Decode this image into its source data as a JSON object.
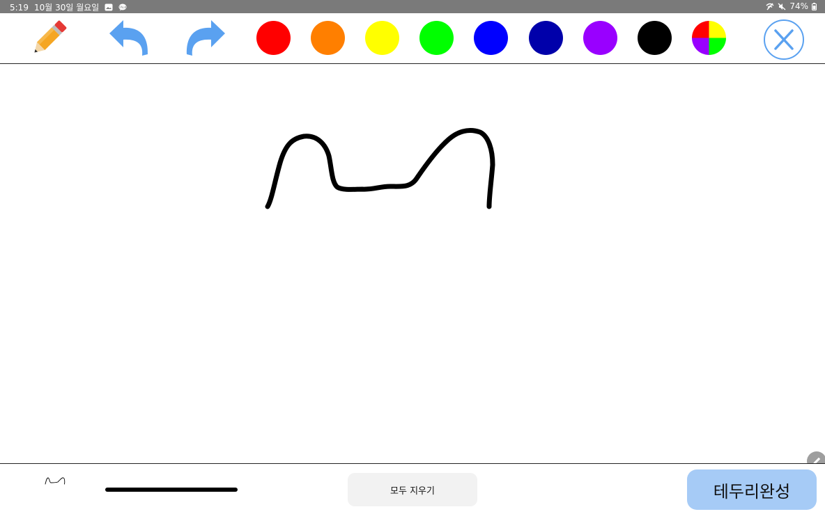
{
  "status_bar": {
    "time": "5:19",
    "date": "10월 30일 월요일",
    "battery": "74%"
  },
  "toolbar": {
    "pencil_icon": "pencil-icon",
    "undo_icon": "undo-arrow-icon",
    "redo_icon": "redo-arrow-icon",
    "close_icon": "close-x-icon",
    "colors": [
      {
        "name": "red",
        "hex": "#ff0000"
      },
      {
        "name": "orange",
        "hex": "#ff7f00"
      },
      {
        "name": "yellow",
        "hex": "#ffff00"
      },
      {
        "name": "green",
        "hex": "#00ff00"
      },
      {
        "name": "blue",
        "hex": "#0000ff"
      },
      {
        "name": "dark-blue",
        "hex": "#0000aa"
      },
      {
        "name": "purple",
        "hex": "#9900ff"
      },
      {
        "name": "black",
        "hex": "#000000"
      },
      {
        "name": "color-picker",
        "hex": "multi"
      }
    ],
    "accent_color": "#5aa1f0"
  },
  "canvas": {
    "stroke_color": "#000000"
  },
  "bottom_bar": {
    "clear_all_label": "모두 지우기",
    "done_label": "테두리완성",
    "done_bg": "#a6cbf6",
    "stroke_size_color": "#000000"
  }
}
